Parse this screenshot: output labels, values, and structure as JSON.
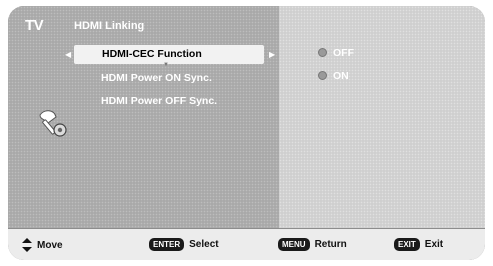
{
  "header": {
    "source": "TV",
    "menu_title": "HDMI Linking"
  },
  "menu": {
    "items": [
      {
        "label": "HDMI-CEC Function",
        "selected": true
      },
      {
        "label": "HDMI Power ON Sync.",
        "selected": false
      },
      {
        "label": "HDMI Power OFF Sync.",
        "selected": false
      }
    ]
  },
  "options": {
    "items": [
      {
        "label": "OFF"
      },
      {
        "label": "ON"
      }
    ]
  },
  "footer": {
    "move_label": "Move",
    "enter_key": "ENTER",
    "select_label": "Select",
    "menu_key": "MENU",
    "return_label": "Return",
    "exit_key": "EXIT",
    "exit_label": "Exit"
  },
  "icons": {
    "setup": "setup-icon",
    "move": "up-down-arrow-icon",
    "left_arrow": "left-arrow-icon",
    "right_arrow": "right-arrow-icon"
  }
}
